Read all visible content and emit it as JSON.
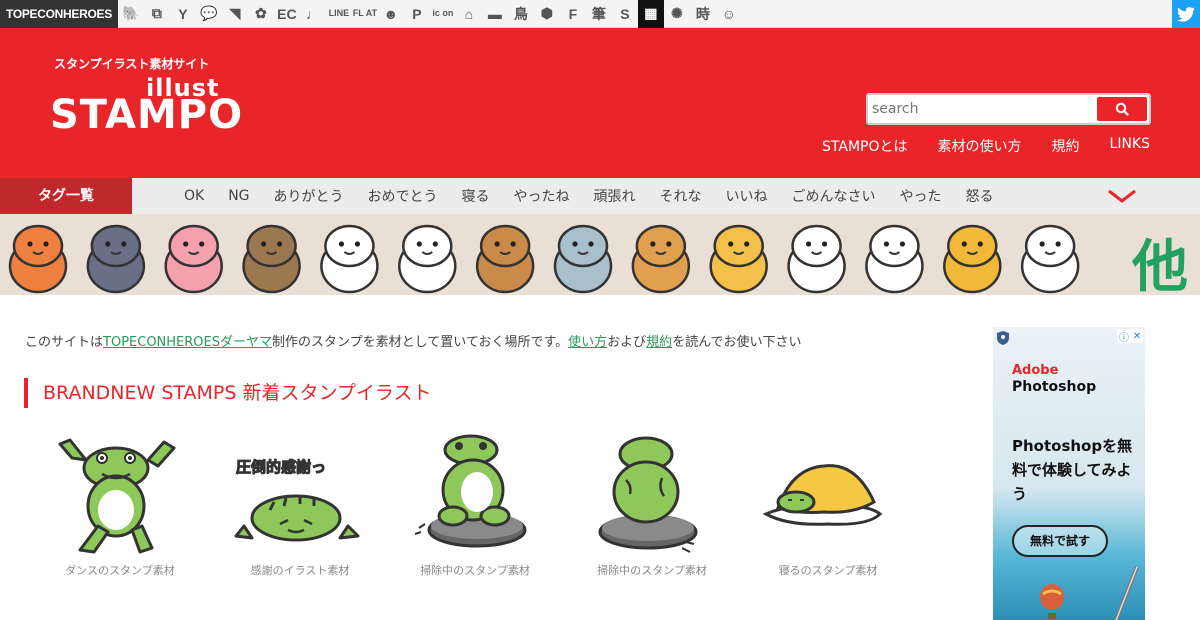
{
  "netbar": {
    "brand": "TOPECONHEROES",
    "sites": [
      {
        "icon": "elephant-icon",
        "glyph": "🐘"
      },
      {
        "icon": "squares-icon",
        "glyph": "⧉"
      },
      {
        "icon": "person-icon",
        "glyph": "Y"
      },
      {
        "icon": "speech-bubble-icon",
        "glyph": "💬"
      },
      {
        "icon": "bird-icon",
        "glyph": "◥"
      },
      {
        "icon": "flower-icon",
        "glyph": "✿"
      },
      {
        "icon": "ec-text-icon",
        "glyph": "EC"
      },
      {
        "icon": "music-note-icon",
        "glyph": "♩"
      },
      {
        "icon": "line-icon",
        "glyph": "LINE"
      },
      {
        "icon": "flat-icon",
        "glyph": "FL AT"
      },
      {
        "icon": "smiley-icon",
        "glyph": "☻"
      },
      {
        "icon": "parking-icon",
        "glyph": "P"
      },
      {
        "icon": "icon-text-icon",
        "glyph": "ic on"
      },
      {
        "icon": "house-icon",
        "glyph": "⌂"
      },
      {
        "icon": "bed-icon",
        "glyph": "▬"
      },
      {
        "icon": "bird-kanji-icon",
        "glyph": "鳥"
      },
      {
        "icon": "hexagon-icon",
        "glyph": "⬢"
      },
      {
        "icon": "f-letter-icon",
        "glyph": "F"
      },
      {
        "icon": "brush-kanji-icon",
        "glyph": "筆"
      },
      {
        "icon": "s-letter-icon",
        "glyph": "S"
      },
      {
        "icon": "grid-icon",
        "glyph": "▦"
      },
      {
        "icon": "sparkle-icon",
        "glyph": "✺"
      },
      {
        "icon": "time-kanji-icon",
        "glyph": "時"
      },
      {
        "icon": "face-icon",
        "glyph": "☺"
      }
    ],
    "twitter_icon": "twitter-icon"
  },
  "header": {
    "tagline": "スタンプイラスト素材サイト",
    "logo_small": "illust",
    "logo_big": "STAMPO",
    "search_placeholder": "search",
    "nav": [
      "STAMPOとは",
      "素材の使い方",
      "規約",
      "LINKS"
    ]
  },
  "tagbar": {
    "label": "タグ一覧",
    "tags": [
      "OK",
      "NG",
      "ありがとう",
      "おめでとう",
      "寝る",
      "やったね",
      "頑張れ",
      "それな",
      "いいね",
      "ごめんなさい",
      "やった",
      "怒る"
    ]
  },
  "strip": {
    "other_label": "他",
    "characters": [
      {
        "name": "octopus",
        "color": "#f08040"
      },
      {
        "name": "penguin-hair",
        "color": "#6a6f88"
      },
      {
        "name": "pink-creature",
        "color": "#f4a0ad"
      },
      {
        "name": "bear-sleeping",
        "color": "#9b7850"
      },
      {
        "name": "radish",
        "color": "#ffffff"
      },
      {
        "name": "cow",
        "color": "#ffffff"
      },
      {
        "name": "squirrel",
        "color": "#c98a4a"
      },
      {
        "name": "koala",
        "color": "#a8c0cc"
      },
      {
        "name": "shiba-dog",
        "color": "#e0a050"
      },
      {
        "name": "yellow-capybara",
        "color": "#f3c14a"
      },
      {
        "name": "white-dog",
        "color": "#ffffff"
      },
      {
        "name": "white-cat",
        "color": "#ffffff"
      },
      {
        "name": "chick-witch",
        "color": "#f1b83a"
      },
      {
        "name": "white-rabbit",
        "color": "#ffffff"
      }
    ]
  },
  "intro": {
    "p1": "このサイトは",
    "link1": "TOPECONHEROESダーヤマ",
    "p2": "制作のスタンプを素材として置いておく場所です。",
    "link2": "使い方",
    "p3": "および",
    "link3": "規約",
    "p4": "を読んでお使い下さい"
  },
  "section": {
    "title": "BRANDNEW STAMPS 新着スタンプイラスト",
    "items": [
      {
        "caption": "ダンスのスタンプ素材",
        "overlay": ""
      },
      {
        "caption": "感謝のイラスト素材",
        "overlay": "圧倒的感謝っ"
      },
      {
        "caption": "掃除中のスタンプ素材",
        "overlay": ""
      },
      {
        "caption": "掃除中のスタンプ素材",
        "overlay": ""
      },
      {
        "caption": "寝るのスタンプ素材",
        "overlay": ""
      }
    ]
  },
  "ad": {
    "brand_line1": "Adobe",
    "brand_line2": "Photoshop",
    "copy": "Photoshopを無料で体験してみよう",
    "cta": "無料で試す"
  },
  "colors": {
    "brand_red": "#e8262a",
    "frog_green": "#8fc85a",
    "link_green": "#2a9a5a"
  }
}
